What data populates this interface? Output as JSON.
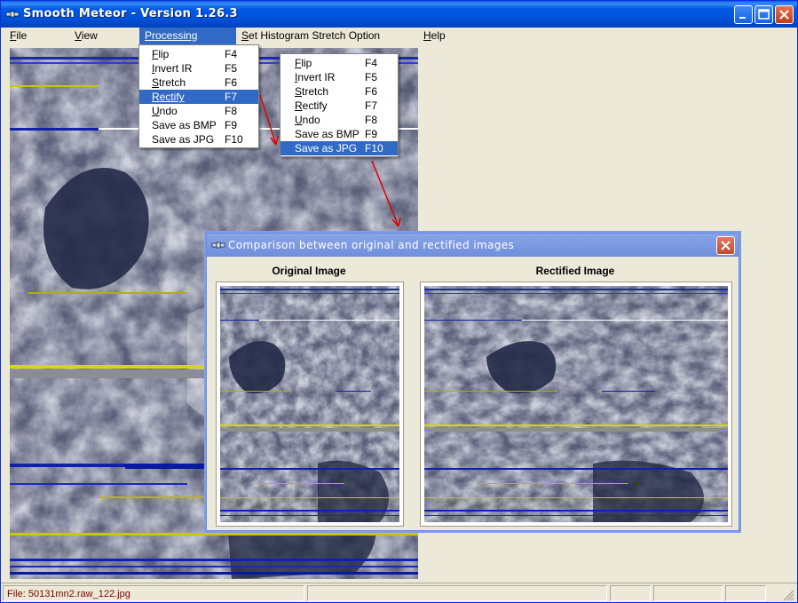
{
  "window": {
    "title": "Smooth Meteor  -  Version 1.26.3"
  },
  "menubar": {
    "file": {
      "mnemonic": "F",
      "rest": "ile"
    },
    "view": {
      "mnemonic": "V",
      "rest": "iew"
    },
    "processing": {
      "mnemonic": "P",
      "rest": "rocessing"
    },
    "histogram": {
      "mnemonic": "S",
      "rest": "et Histogram Stretch Option"
    },
    "help": {
      "mnemonic": "H",
      "rest": "elp"
    }
  },
  "menu1": {
    "items": [
      {
        "mnemonic": "F",
        "rest": "lip",
        "key": "F4"
      },
      {
        "mnemonic": "I",
        "rest": "nvert IR",
        "key": "F5"
      },
      {
        "mnemonic": "S",
        "rest": "tretch",
        "key": "F6"
      },
      {
        "mnemonic": "R",
        "rest": "ectify",
        "key": "F7"
      },
      {
        "mnemonic": "U",
        "rest": "ndo",
        "key": "F8"
      },
      {
        "mnemonic": "",
        "rest": "Save as BMP",
        "key": "F9"
      },
      {
        "mnemonic": "",
        "rest": "Save as JPG",
        "key": "F10"
      }
    ],
    "selected_index": 3
  },
  "menu2": {
    "items": [
      {
        "mnemonic": "F",
        "rest": "lip",
        "key": "F4"
      },
      {
        "mnemonic": "I",
        "rest": "nvert IR",
        "key": "F5"
      },
      {
        "mnemonic": "S",
        "rest": "tretch",
        "key": "F6"
      },
      {
        "mnemonic": "R",
        "rest": "ectify",
        "key": "F7"
      },
      {
        "mnemonic": "U",
        "rest": "ndo",
        "key": "F8"
      },
      {
        "mnemonic": "",
        "rest": "Save as BMP",
        "key": "F9"
      },
      {
        "mnemonic": "",
        "rest": "Save as JPG",
        "key": "F10"
      }
    ],
    "selected_index": 6
  },
  "dialog": {
    "title": "Comparison between original and rectified images",
    "original_caption": "Original Image",
    "rectified_caption": "Rectified Image"
  },
  "statusbar": {
    "text": "File: 50131mn2.raw_122.jpg"
  },
  "colors": {
    "accent": "#316ac5",
    "titlebar": "#0058e6",
    "status_text": "#800000",
    "arrow": "#e00000"
  },
  "icons": {
    "app": "satellite-icon",
    "dialog": "satellite-icon",
    "minimize": "minimize-icon",
    "maximize": "maximize-icon",
    "close": "close-icon"
  }
}
